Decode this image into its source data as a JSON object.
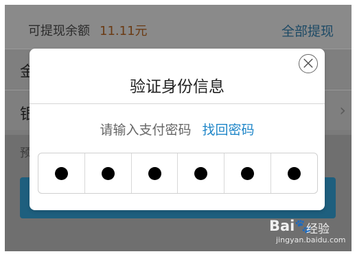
{
  "balance": {
    "label": "可提现余额",
    "amount": "11.11元",
    "withdraw_all": "全部提现"
  },
  "background_rows": {
    "amount_char": "金",
    "bank_char": "银",
    "hint_char": "预",
    "arrow": "›"
  },
  "dialog": {
    "title": "验证身份信息",
    "close_icon": "⨉",
    "prompt": "请输入支付密码",
    "forgot_link": "找回密码",
    "password_digits_entered": 6
  },
  "watermark": {
    "logo": "Bai",
    "logo_suffix": "🐾",
    "text": "经验",
    "url": "jingyan.baidu.com"
  },
  "colors": {
    "accent": "#1f86c8",
    "amount": "#d46b1e",
    "button": "#2a88b8"
  }
}
